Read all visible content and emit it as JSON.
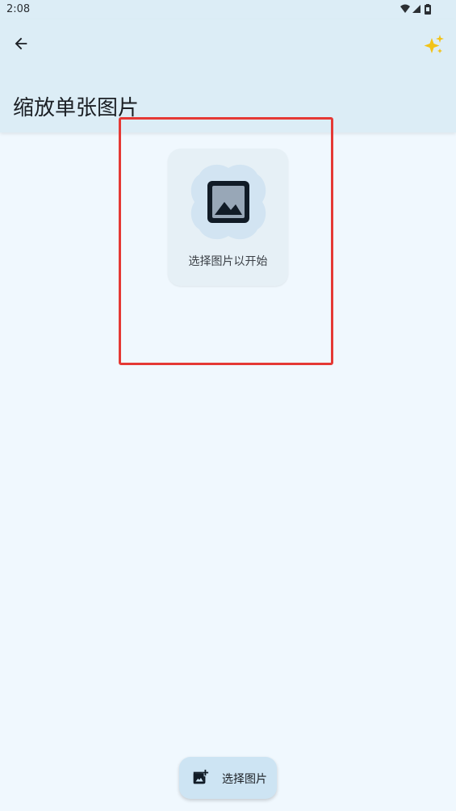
{
  "status_bar": {
    "time": "2:08",
    "icons": [
      "wifi-icon",
      "signal-icon",
      "battery-icon"
    ]
  },
  "app_bar": {
    "back_icon": "arrow-back-icon",
    "magic_icon": "sparkles-icon",
    "title": "缩放单张图片"
  },
  "placeholder": {
    "icon": "image-icon",
    "text": "选择图片以开始"
  },
  "fab": {
    "icon": "add-photo-icon",
    "label": "选择图片"
  },
  "colors": {
    "background": "#f0f8fe",
    "app_bar": "#dcedf6",
    "card": "#e6f0f6",
    "blob": "#d2e4f2",
    "fab": "#cde4f3",
    "highlight": "#e53935",
    "sparkle": "#f2c318"
  }
}
